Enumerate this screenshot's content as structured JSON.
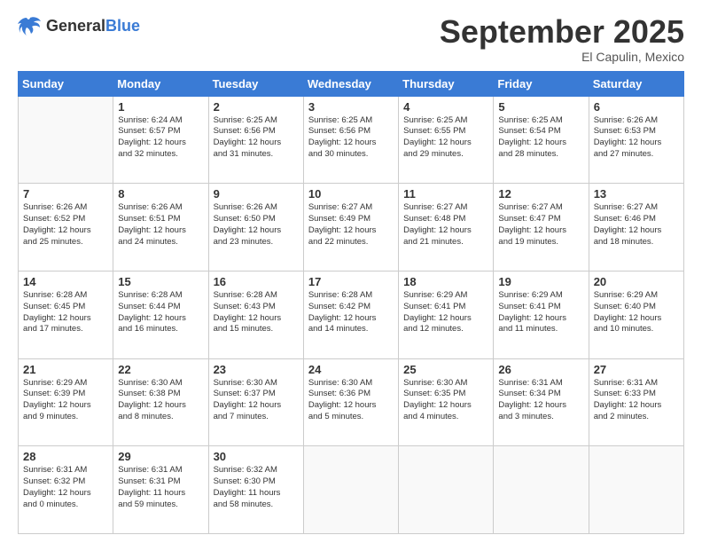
{
  "header": {
    "logo": {
      "general": "General",
      "blue": "Blue"
    },
    "title": "September 2025",
    "subtitle": "El Capulin, Mexico"
  },
  "calendar": {
    "weekdays": [
      "Sunday",
      "Monday",
      "Tuesday",
      "Wednesday",
      "Thursday",
      "Friday",
      "Saturday"
    ],
    "weeks": [
      [
        {
          "day": "",
          "info": ""
        },
        {
          "day": "1",
          "info": "Sunrise: 6:24 AM\nSunset: 6:57 PM\nDaylight: 12 hours\nand 32 minutes."
        },
        {
          "day": "2",
          "info": "Sunrise: 6:25 AM\nSunset: 6:56 PM\nDaylight: 12 hours\nand 31 minutes."
        },
        {
          "day": "3",
          "info": "Sunrise: 6:25 AM\nSunset: 6:56 PM\nDaylight: 12 hours\nand 30 minutes."
        },
        {
          "day": "4",
          "info": "Sunrise: 6:25 AM\nSunset: 6:55 PM\nDaylight: 12 hours\nand 29 minutes."
        },
        {
          "day": "5",
          "info": "Sunrise: 6:25 AM\nSunset: 6:54 PM\nDaylight: 12 hours\nand 28 minutes."
        },
        {
          "day": "6",
          "info": "Sunrise: 6:26 AM\nSunset: 6:53 PM\nDaylight: 12 hours\nand 27 minutes."
        }
      ],
      [
        {
          "day": "7",
          "info": "Sunrise: 6:26 AM\nSunset: 6:52 PM\nDaylight: 12 hours\nand 25 minutes."
        },
        {
          "day": "8",
          "info": "Sunrise: 6:26 AM\nSunset: 6:51 PM\nDaylight: 12 hours\nand 24 minutes."
        },
        {
          "day": "9",
          "info": "Sunrise: 6:26 AM\nSunset: 6:50 PM\nDaylight: 12 hours\nand 23 minutes."
        },
        {
          "day": "10",
          "info": "Sunrise: 6:27 AM\nSunset: 6:49 PM\nDaylight: 12 hours\nand 22 minutes."
        },
        {
          "day": "11",
          "info": "Sunrise: 6:27 AM\nSunset: 6:48 PM\nDaylight: 12 hours\nand 21 minutes."
        },
        {
          "day": "12",
          "info": "Sunrise: 6:27 AM\nSunset: 6:47 PM\nDaylight: 12 hours\nand 19 minutes."
        },
        {
          "day": "13",
          "info": "Sunrise: 6:27 AM\nSunset: 6:46 PM\nDaylight: 12 hours\nand 18 minutes."
        }
      ],
      [
        {
          "day": "14",
          "info": "Sunrise: 6:28 AM\nSunset: 6:45 PM\nDaylight: 12 hours\nand 17 minutes."
        },
        {
          "day": "15",
          "info": "Sunrise: 6:28 AM\nSunset: 6:44 PM\nDaylight: 12 hours\nand 16 minutes."
        },
        {
          "day": "16",
          "info": "Sunrise: 6:28 AM\nSunset: 6:43 PM\nDaylight: 12 hours\nand 15 minutes."
        },
        {
          "day": "17",
          "info": "Sunrise: 6:28 AM\nSunset: 6:42 PM\nDaylight: 12 hours\nand 14 minutes."
        },
        {
          "day": "18",
          "info": "Sunrise: 6:29 AM\nSunset: 6:41 PM\nDaylight: 12 hours\nand 12 minutes."
        },
        {
          "day": "19",
          "info": "Sunrise: 6:29 AM\nSunset: 6:41 PM\nDaylight: 12 hours\nand 11 minutes."
        },
        {
          "day": "20",
          "info": "Sunrise: 6:29 AM\nSunset: 6:40 PM\nDaylight: 12 hours\nand 10 minutes."
        }
      ],
      [
        {
          "day": "21",
          "info": "Sunrise: 6:29 AM\nSunset: 6:39 PM\nDaylight: 12 hours\nand 9 minutes."
        },
        {
          "day": "22",
          "info": "Sunrise: 6:30 AM\nSunset: 6:38 PM\nDaylight: 12 hours\nand 8 minutes."
        },
        {
          "day": "23",
          "info": "Sunrise: 6:30 AM\nSunset: 6:37 PM\nDaylight: 12 hours\nand 7 minutes."
        },
        {
          "day": "24",
          "info": "Sunrise: 6:30 AM\nSunset: 6:36 PM\nDaylight: 12 hours\nand 5 minutes."
        },
        {
          "day": "25",
          "info": "Sunrise: 6:30 AM\nSunset: 6:35 PM\nDaylight: 12 hours\nand 4 minutes."
        },
        {
          "day": "26",
          "info": "Sunrise: 6:31 AM\nSunset: 6:34 PM\nDaylight: 12 hours\nand 3 minutes."
        },
        {
          "day": "27",
          "info": "Sunrise: 6:31 AM\nSunset: 6:33 PM\nDaylight: 12 hours\nand 2 minutes."
        }
      ],
      [
        {
          "day": "28",
          "info": "Sunrise: 6:31 AM\nSunset: 6:32 PM\nDaylight: 12 hours\nand 0 minutes."
        },
        {
          "day": "29",
          "info": "Sunrise: 6:31 AM\nSunset: 6:31 PM\nDaylight: 11 hours\nand 59 minutes."
        },
        {
          "day": "30",
          "info": "Sunrise: 6:32 AM\nSunset: 6:30 PM\nDaylight: 11 hours\nand 58 minutes."
        },
        {
          "day": "",
          "info": ""
        },
        {
          "day": "",
          "info": ""
        },
        {
          "day": "",
          "info": ""
        },
        {
          "day": "",
          "info": ""
        }
      ]
    ]
  }
}
